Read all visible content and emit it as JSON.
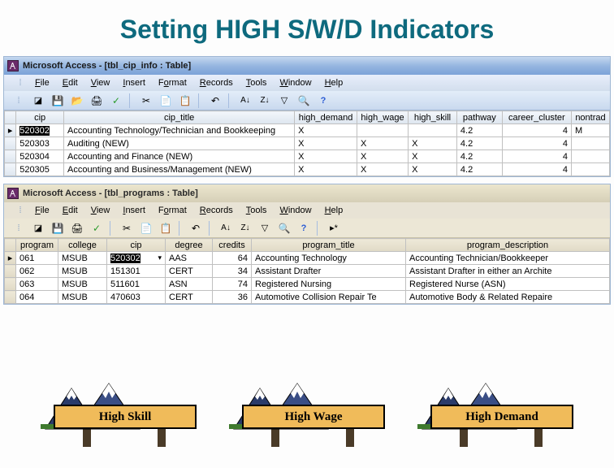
{
  "title": "Setting HIGH S/W/D Indicators",
  "window1": {
    "app_title": "Microsoft Access - [tbl_cip_info : Table]",
    "menu": [
      "File",
      "Edit",
      "View",
      "Insert",
      "Format",
      "Records",
      "Tools",
      "Window",
      "Help"
    ],
    "columns": [
      "cip",
      "cip_title",
      "high_demand",
      "high_wage",
      "high_skill",
      "pathway",
      "career_cluster",
      "nontrad"
    ],
    "rows": [
      {
        "cip": "520302",
        "title": "Accounting Technology/Technician and Bookkeeping",
        "hd": "X",
        "hw": "",
        "hs": "",
        "pathway": "4.2",
        "cc": "4",
        "nt": "M",
        "sel": true
      },
      {
        "cip": "520303",
        "title": "Auditing   (NEW)",
        "hd": "X",
        "hw": "X",
        "hs": "X",
        "pathway": "4.2",
        "cc": "4",
        "nt": ""
      },
      {
        "cip": "520304",
        "title": "Accounting and Finance   (NEW)",
        "hd": "X",
        "hw": "X",
        "hs": "X",
        "pathway": "4.2",
        "cc": "4",
        "nt": ""
      },
      {
        "cip": "520305",
        "title": "Accounting and Business/Management   (NEW)",
        "hd": "X",
        "hw": "X",
        "hs": "X",
        "pathway": "4.2",
        "cc": "4",
        "nt": ""
      }
    ]
  },
  "window2": {
    "app_title": "Microsoft Access - [tbl_programs : Table]",
    "menu": [
      "File",
      "Edit",
      "View",
      "Insert",
      "Format",
      "Records",
      "Tools",
      "Window",
      "Help"
    ],
    "columns": [
      "program",
      "college",
      "cip",
      "degree",
      "credits",
      "program_title",
      "program_description"
    ],
    "rows": [
      {
        "program": "061",
        "college": "MSUB",
        "cip": "520302",
        "degree": "AAS",
        "credits": "64",
        "title": "Accounting Technology",
        "desc": "Accounting Technician/Bookkeeper",
        "sel": true
      },
      {
        "program": "062",
        "college": "MSUB",
        "cip": "151301",
        "degree": "CERT",
        "credits": "34",
        "title": "Assistant Drafter",
        "desc": "Assistant Drafter in either an Archite"
      },
      {
        "program": "063",
        "college": "MSUB",
        "cip": "511601",
        "degree": "ASN",
        "credits": "74",
        "title": "Registered Nursing",
        "desc": "Registered Nurse (ASN)"
      },
      {
        "program": "064",
        "college": "MSUB",
        "cip": "470603",
        "degree": "CERT",
        "credits": "36",
        "title": "Automotive Collision Repair Te",
        "desc": "Automotive Body & Related Repaire"
      }
    ]
  },
  "signs": {
    "skill": "High Skill",
    "wage": "High Wage",
    "demand": "High Demand"
  }
}
